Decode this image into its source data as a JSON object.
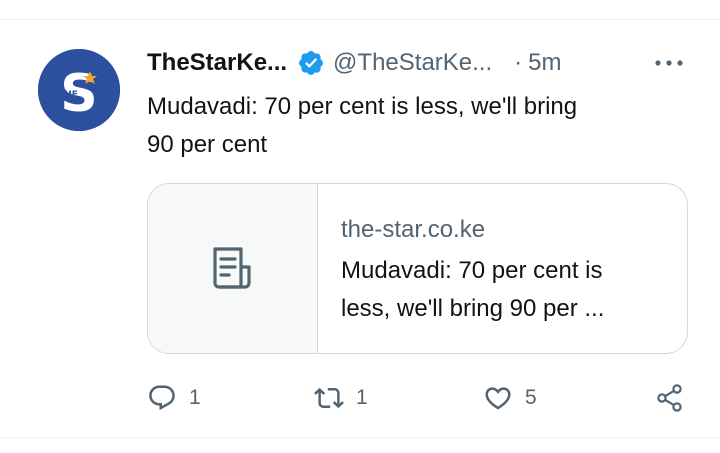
{
  "tweet": {
    "display_name": "TheStarKe...",
    "handle": "@TheStarKe...",
    "separator": "·",
    "time": "5m",
    "text_line1": "Mudavadi: 70 per cent is less, we'll bring",
    "text_line2": "90 per cent",
    "avatar_text": "THE"
  },
  "card": {
    "domain": "the-star.co.ke",
    "title_line1": "Mudavadi: 70 per cent is",
    "title_line2": "less, we'll bring 90 per ..."
  },
  "actions": {
    "reply_count": "1",
    "retweet_count": "1",
    "like_count": "5"
  },
  "icons": {
    "verified": "verified-badge-icon",
    "more": "more-options-icon",
    "article": "article-icon",
    "reply": "reply-icon",
    "retweet": "retweet-icon",
    "like": "like-icon",
    "share": "share-icon"
  },
  "colors": {
    "verified_blue": "#1d9bf0",
    "avatar_bg": "#2c4fa0",
    "secondary_text": "#536471",
    "border": "#cfd9de",
    "star": "#f5a623"
  }
}
